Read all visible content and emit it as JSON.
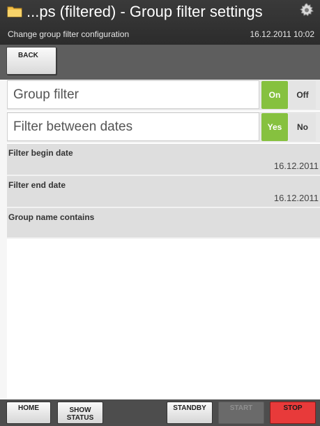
{
  "window": {
    "title": "...ps (filtered) - Group filter settings",
    "subtitle": "Change group filter configuration",
    "datetime": "16.12.2011 10:02",
    "icons": {
      "app": "folder-icon",
      "settings": "gear-icon"
    }
  },
  "toolbar": {
    "back_label": "BACK"
  },
  "settings": {
    "group_filter": {
      "label": "Group filter",
      "on": "On",
      "off": "Off",
      "selected": "On"
    },
    "filter_between_dates": {
      "label": "Filter between dates",
      "yes": "Yes",
      "no": "No",
      "selected": "Yes"
    },
    "filter_begin_date": {
      "label": "Filter begin date",
      "value": "16.12.2011"
    },
    "filter_end_date": {
      "label": "Filter end date",
      "value": "16.12.2011"
    },
    "group_name_contains": {
      "label": "Group name contains",
      "value": ""
    }
  },
  "bottom": {
    "home": "HOME",
    "show_status_line1": "SHOW",
    "show_status_line2": "STATUS",
    "standby": "STANDBY",
    "start": "START",
    "stop": "STOP"
  },
  "colors": {
    "active_green": "#86c13f",
    "stop_red": "#e83a3a",
    "title_bar": "#2c2c2c"
  }
}
